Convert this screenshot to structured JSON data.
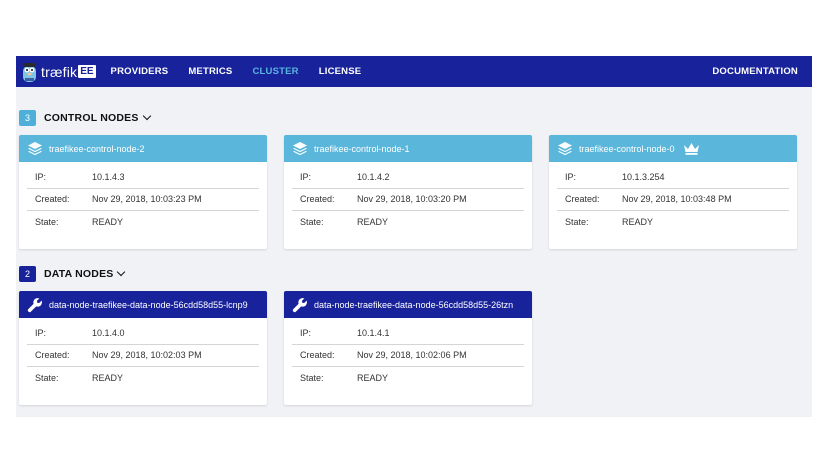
{
  "brand": {
    "logo_text": "træfik",
    "logo_badge": "EE"
  },
  "nav": {
    "items": [
      {
        "label": "PROVIDERS",
        "active": false
      },
      {
        "label": "METRICS",
        "active": false
      },
      {
        "label": "CLUSTER",
        "active": true
      },
      {
        "label": "LICENSE",
        "active": false
      }
    ],
    "documentation": "DOCUMENTATION"
  },
  "colors": {
    "navbar": "#17229b",
    "nav_active": "#5ab6df",
    "control_header": "#5ab6db",
    "data_header": "#17229b",
    "background": "#f0f2f5"
  },
  "control_section": {
    "count": "3",
    "title": "CONTROL NODES",
    "icon": "layers-icon"
  },
  "control_nodes": [
    {
      "name": "traefikee-control-node-2",
      "leader": false,
      "rows": [
        {
          "label": "IP:",
          "value": "10.1.4.3"
        },
        {
          "label": "Created:",
          "value": "Nov 29, 2018, 10:03:23 PM"
        },
        {
          "label": "State:",
          "value": "READY"
        }
      ]
    },
    {
      "name": "traefikee-control-node-1",
      "leader": false,
      "rows": [
        {
          "label": "IP:",
          "value": "10.1.4.2"
        },
        {
          "label": "Created:",
          "value": "Nov 29, 2018, 10:03:20 PM"
        },
        {
          "label": "State:",
          "value": "READY"
        }
      ]
    },
    {
      "name": "traefikee-control-node-0",
      "leader": true,
      "leader_icon": "crown-icon",
      "rows": [
        {
          "label": "IP:",
          "value": "10.1.3.254"
        },
        {
          "label": "Created:",
          "value": "Nov 29, 2018, 10:03:48 PM"
        },
        {
          "label": "State:",
          "value": "READY"
        }
      ]
    }
  ],
  "data_section": {
    "count": "2",
    "title": "DATA NODES",
    "icon": "wrench-icon"
  },
  "data_nodes": [
    {
      "name": "data-node-traefikee-data-node-56cdd58d55-lcnp9",
      "rows": [
        {
          "label": "IP:",
          "value": "10.1.4.0"
        },
        {
          "label": "Created:",
          "value": "Nov 29, 2018, 10:02:03 PM"
        },
        {
          "label": "State:",
          "value": "READY"
        }
      ]
    },
    {
      "name": "data-node-traefikee-data-node-56cdd58d55-26tzn",
      "rows": [
        {
          "label": "IP:",
          "value": "10.1.4.1"
        },
        {
          "label": "Created:",
          "value": "Nov 29, 2018, 10:02:06 PM"
        },
        {
          "label": "State:",
          "value": "READY"
        }
      ]
    }
  ]
}
